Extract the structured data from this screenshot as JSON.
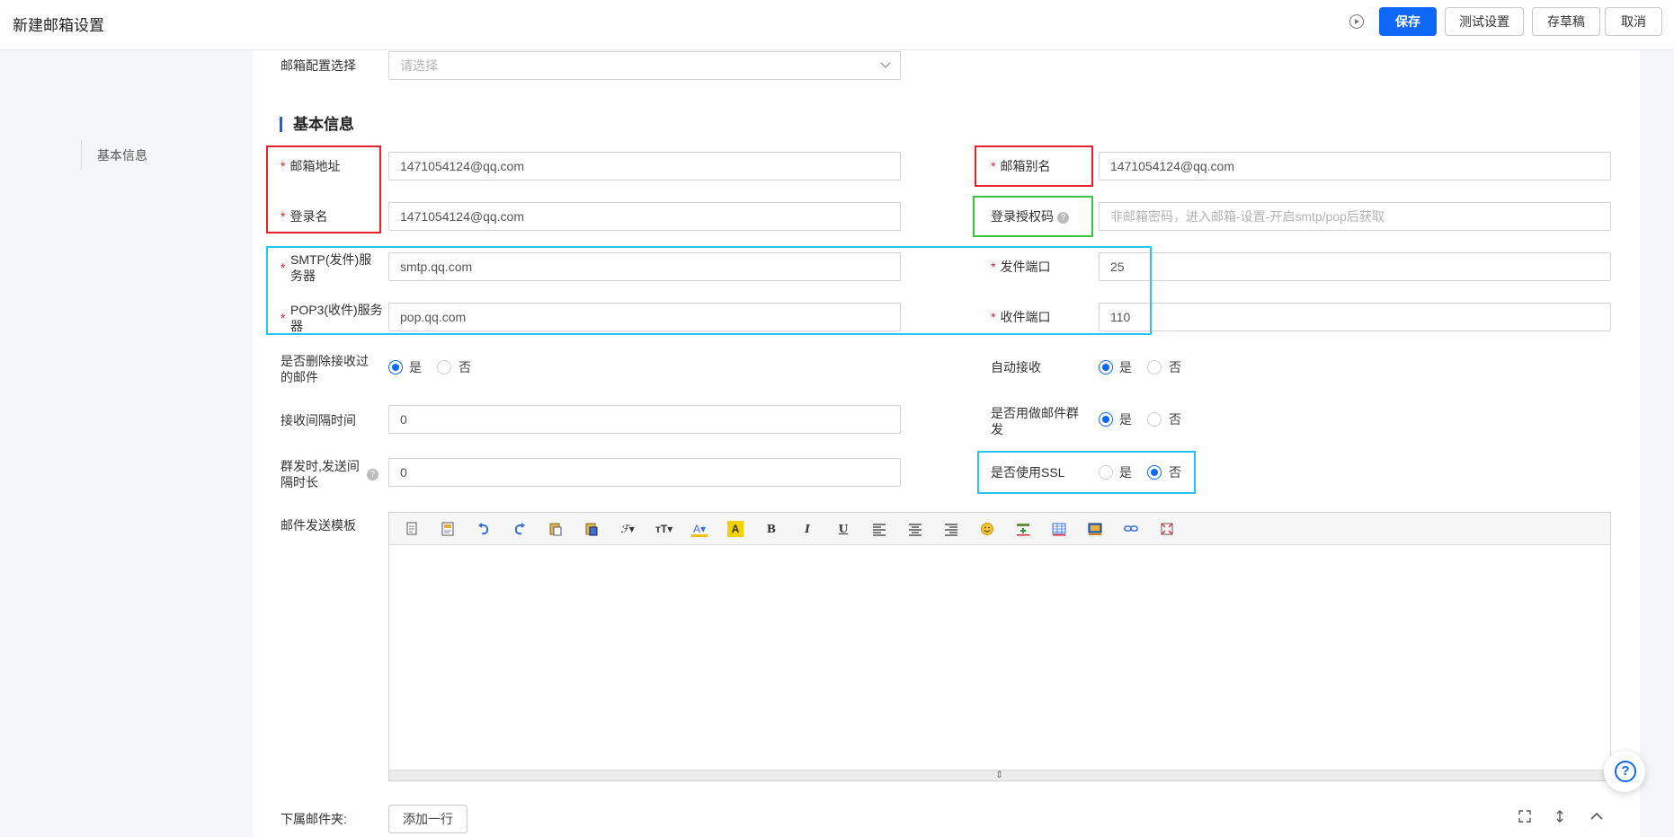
{
  "header": {
    "title": "新建邮箱设置",
    "buttons": {
      "save": "保存",
      "test": "测试设置",
      "draft": "存草稿",
      "cancel": "取消"
    }
  },
  "sidebar": {
    "items": [
      {
        "label": "基本信息"
      }
    ]
  },
  "form": {
    "config_select": {
      "label": "邮箱配置选择",
      "placeholder": "请选择"
    },
    "section_title": "基本信息",
    "email_address": {
      "label": "邮箱地址",
      "value": "1471054124@qq.com"
    },
    "email_alias": {
      "label": "邮箱别名",
      "value": "1471054124@qq.com"
    },
    "login_name": {
      "label": "登录名",
      "value": "1471054124@qq.com"
    },
    "auth_code": {
      "label": "登录授权码",
      "placeholder": "非邮箱密码，进入邮箱-设置-开启smtp/pop后获取"
    },
    "smtp_server": {
      "label_line1": "SMTP(发件)服",
      "label_line2": "务器",
      "value": "smtp.qq.com"
    },
    "send_port": {
      "label": "发件端口",
      "value": "25"
    },
    "pop3_server": {
      "label_line1": "POP3(收件)服务",
      "label_line2": "器",
      "value": "pop.qq.com"
    },
    "receive_port": {
      "label": "收件端口",
      "value": "110"
    },
    "delete_received": {
      "label_line1": "是否删除接收过",
      "label_line2": "的邮件",
      "yes": "是",
      "no": "否",
      "selected": "是"
    },
    "auto_receive": {
      "label": "自动接收",
      "yes": "是",
      "no": "否",
      "selected": "是"
    },
    "receive_interval": {
      "label": "接收间隔时间",
      "value": "0"
    },
    "mass_send": {
      "label_line1": "是否用做邮件群",
      "label_line2": "发",
      "yes": "是",
      "no": "否",
      "selected": "是"
    },
    "send_interval": {
      "label_line1": "群发时,发送间",
      "label_line2": "隔时长",
      "value": "0"
    },
    "use_ssl": {
      "label": "是否使用SSL",
      "yes": "是",
      "no": "否",
      "selected": "否"
    },
    "template": {
      "label": "邮件发送模板"
    },
    "subfolder": {
      "label": "下属邮件夹:",
      "add_row": "添加一行"
    }
  },
  "colors": {
    "primary": "#0e67f5",
    "required": "#e23333",
    "highlight_red": "#e8222b",
    "highlight_green": "#3cc43c",
    "highlight_blue": "#25c4f2"
  },
  "editor_toolbar_icons": [
    "source-icon",
    "template-icon",
    "undo-icon",
    "redo-icon",
    "paste-icon",
    "paste-word-icon",
    "font-family-icon",
    "font-size-icon",
    "font-color-icon",
    "highlight-color-icon",
    "bold-icon",
    "italic-icon",
    "underline-icon",
    "align-left-icon",
    "align-center-icon",
    "align-right-icon",
    "emoji-icon",
    "insert-image-icon",
    "table-icon",
    "media-icon",
    "link-icon",
    "fullscreen-icon"
  ]
}
